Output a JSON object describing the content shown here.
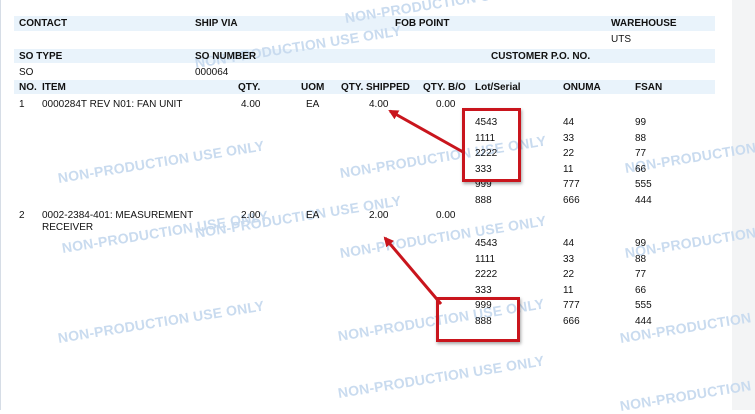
{
  "watermark": "NON-PRODUCTION USE ONLY",
  "header": {
    "contact_label": "CONTACT",
    "ship_via_label": "SHIP VIA",
    "fob_point_label": "FOB POINT",
    "warehouse_label": "WAREHOUSE",
    "warehouse_value": "UTS",
    "so_type_label": "SO TYPE",
    "so_type_value": "SO",
    "so_number_label": "SO NUMBER",
    "so_number_value": "000064",
    "customer_po_label": "CUSTOMER P.O. NO."
  },
  "columns": {
    "no": "NO.",
    "item": "ITEM",
    "qty": "QTY.",
    "uom": "UOM",
    "qty_shipped": "QTY. SHIPPED",
    "qty_bo": "QTY. B/O",
    "lot_serial": "Lot/Serial",
    "onuma": "ONUMA",
    "fsan": "FSAN"
  },
  "lines": [
    {
      "no": "1",
      "item_line1": "0000284T REV N01: FAN UNIT",
      "item_line2": "",
      "qty": "4.00",
      "uom": "EA",
      "qty_shipped": "4.00",
      "qty_bo": "0.00",
      "serials": [
        {
          "lot": "4543",
          "onuma": "44",
          "fsan": "99"
        },
        {
          "lot": "1111",
          "onuma": "33",
          "fsan": "88"
        },
        {
          "lot": "2222",
          "onuma": "22",
          "fsan": "77"
        },
        {
          "lot": "333",
          "onuma": "11",
          "fsan": "66"
        },
        {
          "lot": "999",
          "onuma": "777",
          "fsan": "555"
        },
        {
          "lot": "888",
          "onuma": "666",
          "fsan": "444"
        }
      ]
    },
    {
      "no": "2",
      "item_line1": "0002-2384-401: MEASUREMENT",
      "item_line2": "RECEIVER",
      "qty": "2.00",
      "uom": "EA",
      "qty_shipped": "2.00",
      "qty_bo": "0.00",
      "serials": [
        {
          "lot": "4543",
          "onuma": "44",
          "fsan": "99"
        },
        {
          "lot": "1111",
          "onuma": "33",
          "fsan": "88"
        },
        {
          "lot": "2222",
          "onuma": "22",
          "fsan": "77"
        },
        {
          "lot": "333",
          "onuma": "11",
          "fsan": "66"
        },
        {
          "lot": "999",
          "onuma": "777",
          "fsan": "555"
        },
        {
          "lot": "888",
          "onuma": "666",
          "fsan": "444"
        }
      ]
    }
  ],
  "annotation_color": "#c9151d"
}
